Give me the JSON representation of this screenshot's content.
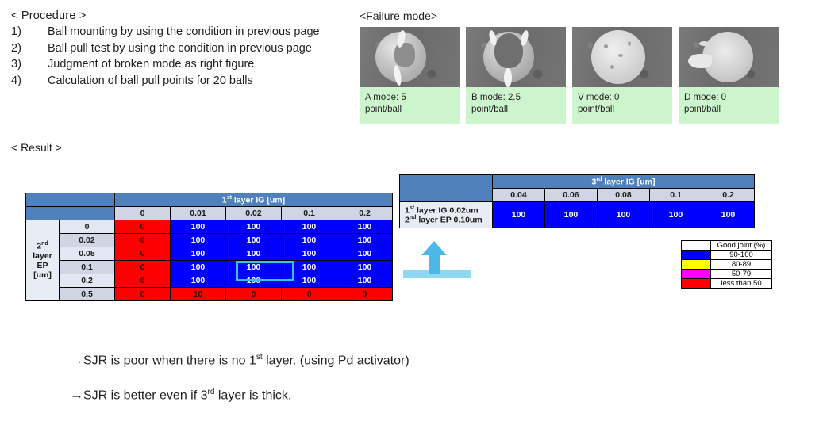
{
  "procedure": {
    "heading": "< Procedure >",
    "steps": [
      {
        "num": "1)",
        "text": "Ball mounting by using the condition in previous page"
      },
      {
        "num": "2)",
        "text": "Ball pull test by using the condition in previous page"
      },
      {
        "num": "3)",
        "text": "Judgment of broken mode as right figure"
      },
      {
        "num": "4)",
        "text": "Calculation of ball pull points for 20 balls"
      }
    ]
  },
  "failure_mode": {
    "title": "<Failure mode>",
    "tiles": [
      {
        "name": "A mode",
        "line1": "A mode: 5",
        "line2": "point/ball",
        "points": 5
      },
      {
        "name": "B mode",
        "line1": "B mode: 2.5",
        "line2": "point/ball",
        "points": 2.5
      },
      {
        "name": "V mode",
        "line1": "V mode: 0",
        "line2": "point/ball",
        "points": 0
      },
      {
        "name": "D mode",
        "line1": "D mode: 0",
        "line2": "point/ball",
        "points": 0
      }
    ],
    "caption_bg": "#cdf5cd"
  },
  "result_label": "< Result >",
  "left_table": {
    "col_group_label_pre": "1",
    "col_group_label_sup": "st",
    "col_group_label_post": " layer IG [um]",
    "col_headers": [
      "0",
      "0.01",
      "0.02",
      "0.1",
      "0.2"
    ],
    "row_group_label_pre": "2",
    "row_group_label_sup": "nd",
    "row_group_label_l1": " layer",
    "row_group_label_l2": "EP",
    "row_group_label_l3": "[um]",
    "row_headers": [
      "0",
      "0.02",
      "0.05",
      "0.1",
      "0.2",
      "0.5"
    ],
    "rows": [
      [
        "0",
        "100",
        "100",
        "100",
        "100"
      ],
      [
        "0",
        "100",
        "100",
        "100",
        "100"
      ],
      [
        "0",
        "100",
        "100",
        "100",
        "100"
      ],
      [
        "0",
        "100",
        "100",
        "100",
        "100"
      ],
      [
        "0",
        "100",
        "100",
        "100",
        "100"
      ],
      [
        "0",
        "10",
        "0",
        "0",
        "0"
      ]
    ],
    "highlight_cell": {
      "row": "0.1",
      "col": "0.02",
      "value": "100",
      "color": "#2ec5ef"
    }
  },
  "right_table": {
    "col_group_label_pre": "3",
    "col_group_label_sup": "rd",
    "col_group_label_post": " layer IG [um]",
    "col_headers": [
      "0.04",
      "0.06",
      "0.08",
      "0.1",
      "0.2"
    ],
    "row_label_1_pre": "1",
    "row_label_1_sup": "st",
    "row_label_1_post": " layer IG 0.02um",
    "row_label_2_pre": "2",
    "row_label_2_sup": "nd",
    "row_label_2_post": " layer EP 0.10um",
    "values": [
      "100",
      "100",
      "100",
      "100",
      "100"
    ]
  },
  "legend": {
    "header": "Good joint (%)",
    "rows": [
      {
        "color": "#ffffff",
        "label": "90-100"
      },
      {
        "color": "#0000ff",
        "label": "80-89"
      },
      {
        "color": "#ffff00",
        "label": "50-79"
      },
      {
        "color": "#ff00ff",
        "label": "less than 50"
      },
      {
        "color": "#ff0000",
        "label": ""
      }
    ],
    "swatches": [
      "#ffffff",
      "#0000ff",
      "#ffff00",
      "#ff00ff",
      "#ff0000"
    ],
    "labels": [
      "Good joint (%)",
      "90-100",
      "80-89",
      "50-79",
      "less than 50"
    ]
  },
  "conclusions": [
    {
      "arrow": "→",
      "pre": "SJR is poor when there is no 1",
      "sup": "st",
      "post": " layer. (using Pd activator)"
    },
    {
      "arrow": "→",
      "pre": "SJR is better even if 3",
      "sup": "rd",
      "post": " layer is thick."
    }
  ],
  "colors": {
    "header_blue": "#4f81bd",
    "subheader": "#d0d5e4",
    "cell_blue": "#0000ff",
    "cell_red": "#ff0000",
    "highlight": "#2ec5ef",
    "caption_green": "#cdf5cd"
  }
}
